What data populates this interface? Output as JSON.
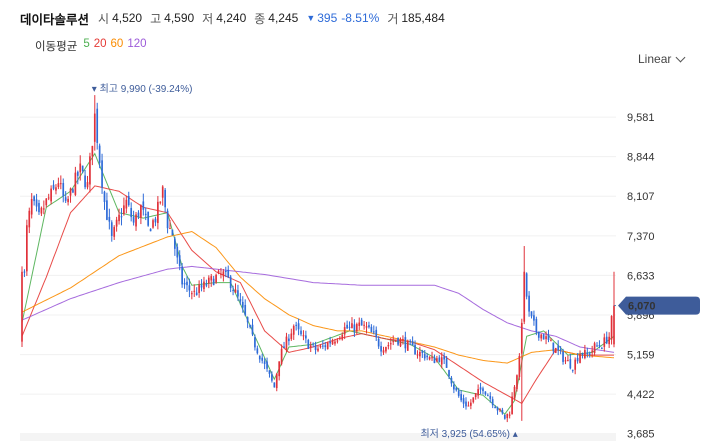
{
  "header": {
    "name": "데이타솔루션",
    "open_label": "시",
    "open": "4,520",
    "high_label": "고",
    "high": "4,590",
    "low_label": "저",
    "low": "4,240",
    "close_label": "종",
    "close": "4,245",
    "change": "395",
    "change_pct": "-8.51%",
    "volume_label": "거",
    "volume": "185,484"
  },
  "ma_legend": {
    "title": "이동평균",
    "items": [
      {
        "label": "5",
        "color": "#4caf50"
      },
      {
        "label": "20",
        "color": "#e53935"
      },
      {
        "label": "60",
        "color": "#fb8c00"
      },
      {
        "label": "120",
        "color": "#9c5bd9"
      }
    ]
  },
  "scale_button": {
    "label": "Linear"
  },
  "chart_data": {
    "type": "candlestick",
    "title": "",
    "xlabel": "",
    "ylabel": "",
    "yticks": [
      9581,
      8844,
      8107,
      7370,
      6633,
      5896,
      5159,
      4422,
      3685
    ],
    "ytick_labels": [
      "9,581",
      "8,844",
      "8,107",
      "7,370",
      "6,633",
      "5,896",
      "5,159",
      "4,422",
      "3,685"
    ],
    "ylim": [
      3550,
      10420
    ],
    "current_price": 6070,
    "current_price_label": "6,070",
    "current_price_color": "#3e5c9a",
    "up_color": "#e0313a",
    "down_color": "#2e6bd8",
    "max_annotation": {
      "text": "최고 9,990 (-39.24%)",
      "value": 9990,
      "index": 30
    },
    "min_annotation": {
      "text": "최저 3,925 (54.65%)",
      "value": 3925,
      "index": 206
    },
    "anchors": [
      [
        0,
        5800
      ],
      [
        2,
        7500
      ],
      [
        4,
        8000
      ],
      [
        7,
        7700
      ],
      [
        10,
        8000
      ],
      [
        13,
        8200
      ],
      [
        15,
        8400
      ],
      [
        18,
        7900
      ],
      [
        21,
        8300
      ],
      [
        24,
        8600
      ],
      [
        27,
        8300
      ],
      [
        30,
        9600
      ],
      [
        32,
        8800
      ],
      [
        34,
        8000
      ],
      [
        37,
        7300
      ],
      [
        40,
        7700
      ],
      [
        43,
        8000
      ],
      [
        46,
        7600
      ],
      [
        49,
        7900
      ],
      [
        52,
        7500
      ],
      [
        55,
        7700
      ],
      [
        58,
        8200
      ],
      [
        60,
        7600
      ],
      [
        62,
        7400
      ],
      [
        64,
        6900
      ],
      [
        66,
        6500
      ],
      [
        68,
        6400
      ],
      [
        71,
        6300
      ],
      [
        74,
        6400
      ],
      [
        77,
        6500
      ],
      [
        80,
        6600
      ],
      [
        83,
        6650
      ],
      [
        86,
        6500
      ],
      [
        89,
        6200
      ],
      [
        92,
        5850
      ],
      [
        95,
        5450
      ],
      [
        98,
        5150
      ],
      [
        101,
        4850
      ],
      [
        104,
        4550
      ],
      [
        106,
        5100
      ],
      [
        109,
        5400
      ],
      [
        112,
        5700
      ],
      [
        115,
        5500
      ],
      [
        118,
        5350
      ],
      [
        121,
        5250
      ],
      [
        124,
        5300
      ],
      [
        127,
        5400
      ],
      [
        130,
        5500
      ],
      [
        133,
        5650
      ],
      [
        136,
        5650
      ],
      [
        139,
        5700
      ],
      [
        142,
        5650
      ],
      [
        145,
        5500
      ],
      [
        148,
        5300
      ],
      [
        151,
        5350
      ],
      [
        154,
        5450
      ],
      [
        157,
        5400
      ],
      [
        160,
        5300
      ],
      [
        163,
        5200
      ],
      [
        166,
        5150
      ],
      [
        169,
        5050
      ],
      [
        172,
        5100
      ],
      [
        175,
        4950
      ],
      [
        178,
        4550
      ],
      [
        181,
        4300
      ],
      [
        184,
        4200
      ],
      [
        187,
        4400
      ],
      [
        190,
        4550
      ],
      [
        193,
        4350
      ],
      [
        196,
        4150
      ],
      [
        199,
        3980
      ],
      [
        201,
        4100
      ],
      [
        203,
        4600
      ],
      [
        205,
        5050
      ],
      [
        207,
        6600
      ],
      [
        209,
        5900
      ],
      [
        212,
        5600
      ],
      [
        215,
        5500
      ],
      [
        218,
        5350
      ],
      [
        221,
        5200
      ],
      [
        224,
        5050
      ],
      [
        227,
        4950
      ],
      [
        230,
        5200
      ],
      [
        233,
        5150
      ],
      [
        236,
        5300
      ],
      [
        239,
        5350
      ],
      [
        242,
        5500
      ],
      [
        244,
        6070
      ]
    ],
    "ma": {
      "ma5": [
        [
          0,
          5750
        ],
        [
          10,
          7900
        ],
        [
          20,
          8200
        ],
        [
          30,
          8900
        ],
        [
          40,
          7800
        ],
        [
          50,
          7700
        ],
        [
          60,
          7800
        ],
        [
          66,
          6800
        ],
        [
          70,
          6450
        ],
        [
          80,
          6500
        ],
        [
          86,
          6500
        ],
        [
          95,
          5600
        ],
        [
          104,
          4700
        ],
        [
          110,
          5300
        ],
        [
          120,
          5350
        ],
        [
          135,
          5600
        ],
        [
          145,
          5500
        ],
        [
          160,
          5350
        ],
        [
          170,
          5100
        ],
        [
          180,
          4500
        ],
        [
          190,
          4400
        ],
        [
          199,
          4050
        ],
        [
          203,
          4300
        ],
        [
          208,
          5500
        ],
        [
          215,
          5600
        ],
        [
          225,
          5150
        ],
        [
          235,
          5200
        ],
        [
          244,
          5500
        ]
      ],
      "ma20": [
        [
          0,
          5500
        ],
        [
          10,
          6600
        ],
        [
          20,
          7800
        ],
        [
          30,
          8300
        ],
        [
          40,
          8200
        ],
        [
          50,
          7900
        ],
        [
          60,
          7800
        ],
        [
          70,
          7100
        ],
        [
          80,
          6700
        ],
        [
          90,
          6500
        ],
        [
          100,
          5600
        ],
        [
          110,
          5200
        ],
        [
          120,
          5300
        ],
        [
          130,
          5450
        ],
        [
          140,
          5550
        ],
        [
          150,
          5450
        ],
        [
          160,
          5400
        ],
        [
          170,
          5250
        ],
        [
          180,
          4950
        ],
        [
          190,
          4650
        ],
        [
          200,
          4400
        ],
        [
          206,
          4250
        ],
        [
          212,
          4700
        ],
        [
          220,
          5250
        ],
        [
          230,
          5150
        ],
        [
          244,
          5150
        ]
      ],
      "ma60": [
        [
          0,
          5950
        ],
        [
          20,
          6400
        ],
        [
          40,
          7000
        ],
        [
          60,
          7350
        ],
        [
          70,
          7450
        ],
        [
          80,
          7150
        ],
        [
          90,
          6600
        ],
        [
          100,
          6200
        ],
        [
          110,
          5900
        ],
        [
          120,
          5700
        ],
        [
          130,
          5600
        ],
        [
          140,
          5600
        ],
        [
          150,
          5500
        ],
        [
          160,
          5400
        ],
        [
          170,
          5300
        ],
        [
          180,
          5150
        ],
        [
          190,
          5050
        ],
        [
          200,
          5000
        ],
        [
          210,
          5200
        ],
        [
          220,
          5250
        ],
        [
          230,
          5150
        ],
        [
          244,
          5100
        ]
      ],
      "ma120": [
        [
          0,
          5800
        ],
        [
          20,
          6200
        ],
        [
          40,
          6500
        ],
        [
          60,
          6750
        ],
        [
          70,
          6800
        ],
        [
          80,
          6750
        ],
        [
          100,
          6650
        ],
        [
          120,
          6500
        ],
        [
          140,
          6450
        ],
        [
          160,
          6450
        ],
        [
          170,
          6450
        ],
        [
          180,
          6300
        ],
        [
          190,
          6000
        ],
        [
          200,
          5750
        ],
        [
          210,
          5600
        ],
        [
          220,
          5500
        ],
        [
          230,
          5300
        ],
        [
          244,
          5200
        ]
      ]
    }
  }
}
